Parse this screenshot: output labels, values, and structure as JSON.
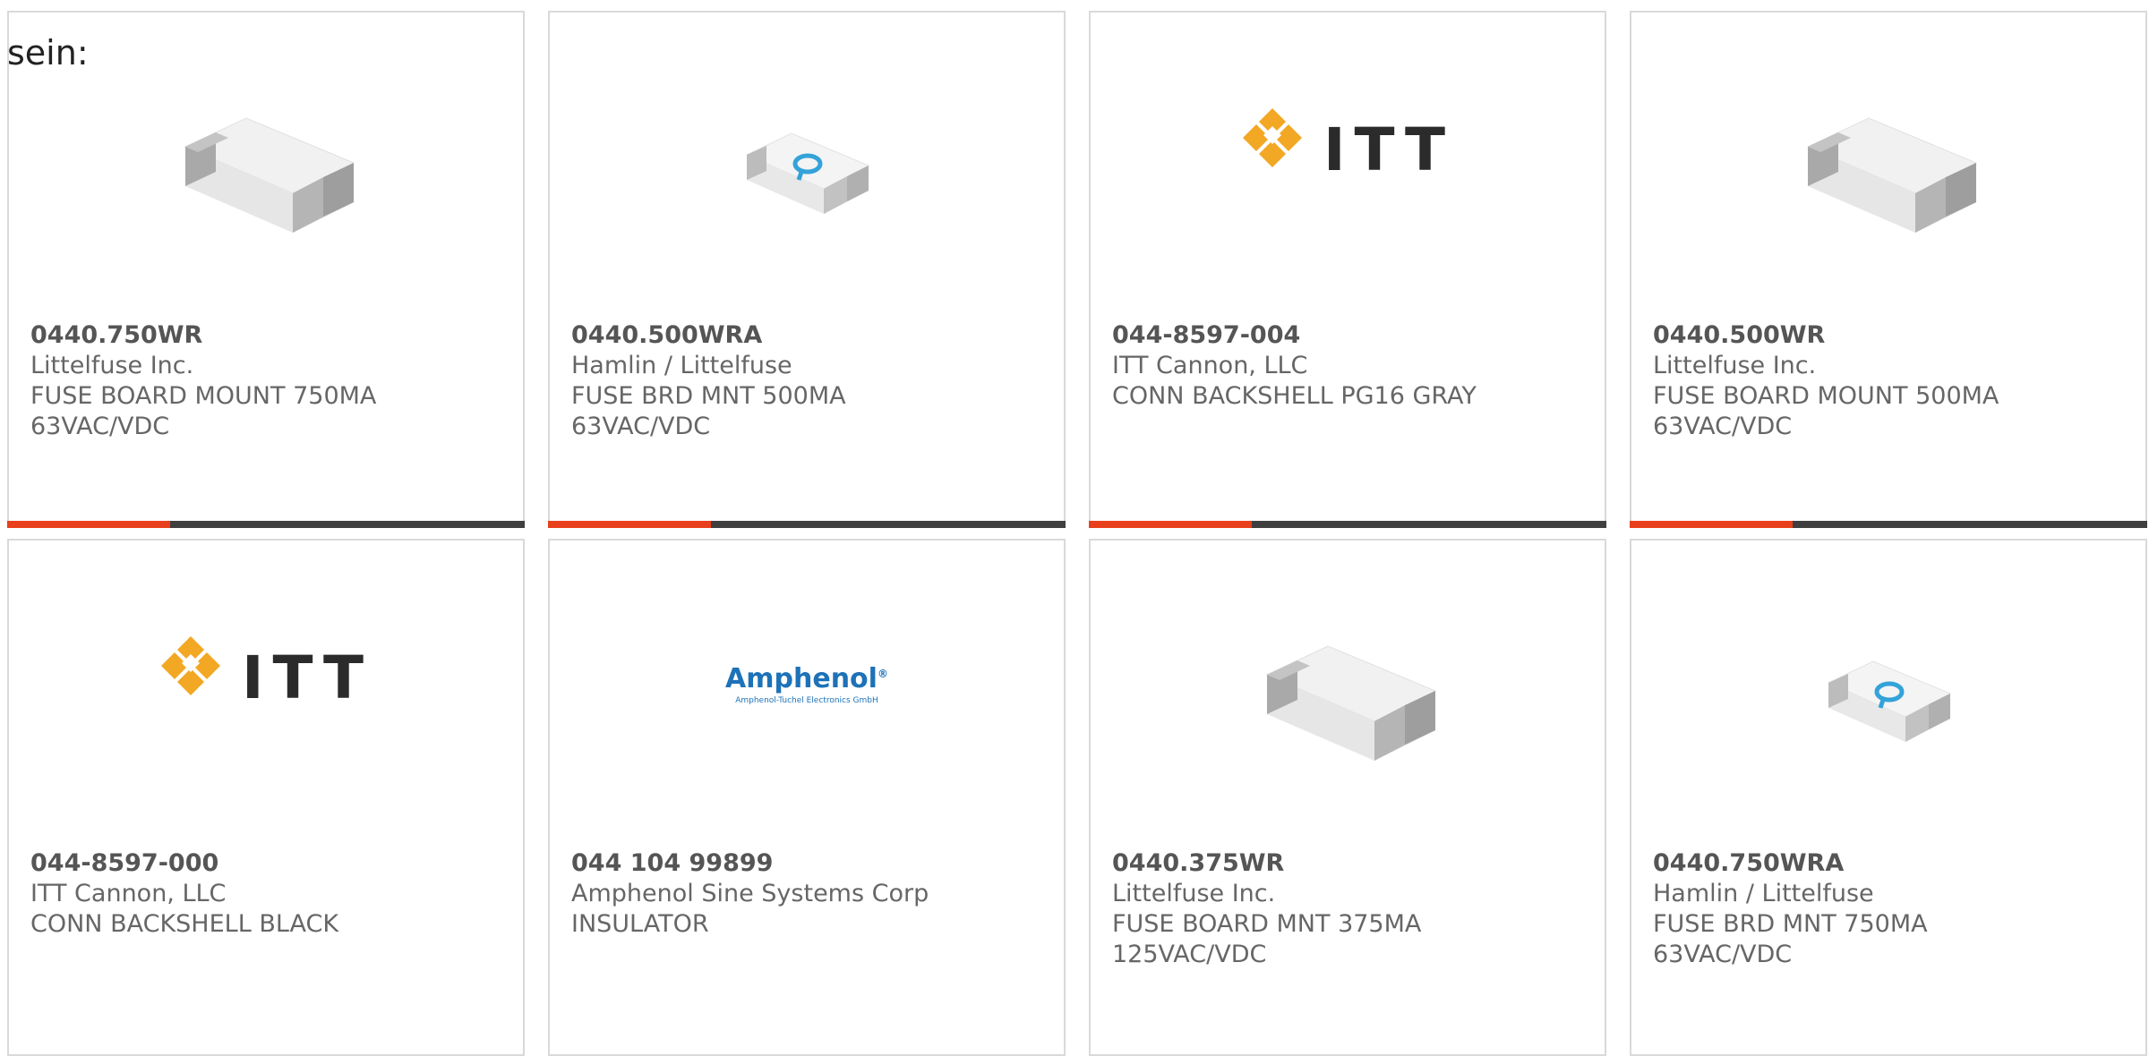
{
  "intro_text": "sein:",
  "colors": {
    "accent": "#e8401c",
    "bar_dark": "#3f3f3f",
    "text": "#666666"
  },
  "products": [
    {
      "part_number": "0440.750WR",
      "manufacturer": "Littelfuse Inc.",
      "description_line1": "FUSE BOARD MOUNT 750MA",
      "description_line2": "63VAC/VDC",
      "image": "white-smd-fuse"
    },
    {
      "part_number": "0440.500WRA",
      "manufacturer": "Hamlin / Littelfuse",
      "description_line1": "FUSE BRD MNT 500MA",
      "description_line2": "63VAC/VDC",
      "image": "clear-smd-fuse"
    },
    {
      "part_number": "044-8597-004",
      "manufacturer": "ITT Cannon, LLC",
      "description_line1": "CONN BACKSHELL PG16 GRAY",
      "description_line2": "",
      "image": "itt-logo",
      "logo_text": "ITT"
    },
    {
      "part_number": "0440.500WR",
      "manufacturer": "Littelfuse Inc.",
      "description_line1": "FUSE BOARD MOUNT 500MA",
      "description_line2": "63VAC/VDC",
      "image": "white-smd-fuse"
    },
    {
      "part_number": "044-8597-000",
      "manufacturer": "ITT Cannon, LLC",
      "description_line1": "CONN BACKSHELL BLACK",
      "description_line2": "",
      "image": "itt-logo",
      "logo_text": "ITT"
    },
    {
      "part_number": "044 104 99899",
      "manufacturer": "Amphenol Sine Systems Corp",
      "description_line1": "INSULATOR",
      "description_line2": "",
      "image": "amphenol-logo",
      "logo_text": "Amphenol",
      "logo_subtext": "Amphenol-Tuchel Electronics GmbH"
    },
    {
      "part_number": "0440.375WR",
      "manufacturer": "Littelfuse Inc.",
      "description_line1": "FUSE BOARD MNT 375MA",
      "description_line2": "125VAC/VDC",
      "image": "white-smd-fuse"
    },
    {
      "part_number": "0440.750WRA",
      "manufacturer": "Hamlin / Littelfuse",
      "description_line1": "FUSE BRD MNT 750MA",
      "description_line2": "63VAC/VDC",
      "image": "clear-smd-fuse"
    }
  ]
}
